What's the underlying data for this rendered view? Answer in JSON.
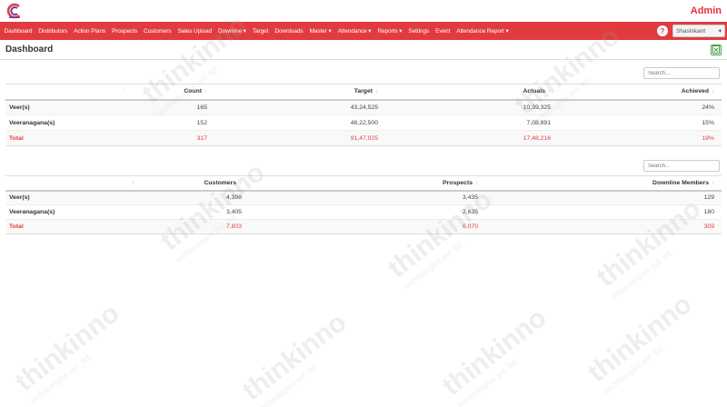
{
  "header": {
    "admin_label": "Admin"
  },
  "nav": {
    "items": [
      {
        "label": "Dashboard",
        "dropdown": false
      },
      {
        "label": "Distributors",
        "dropdown": false
      },
      {
        "label": "Action Plans",
        "dropdown": false
      },
      {
        "label": "Prospects",
        "dropdown": false
      },
      {
        "label": "Customers",
        "dropdown": false
      },
      {
        "label": "Sales Upload",
        "dropdown": false
      },
      {
        "label": "Downline ▾",
        "dropdown": true
      },
      {
        "label": "Target",
        "dropdown": false
      },
      {
        "label": "Downloads",
        "dropdown": false
      },
      {
        "label": "Master ▾",
        "dropdown": true
      },
      {
        "label": "Attendance ▾",
        "dropdown": true
      },
      {
        "label": "Reports ▾",
        "dropdown": true
      },
      {
        "label": "Settings",
        "dropdown": false
      },
      {
        "label": "Event",
        "dropdown": false
      },
      {
        "label": "Attendance Report ▾",
        "dropdown": true
      }
    ],
    "help_icon": "?",
    "user": "Shashikant"
  },
  "page": {
    "title": "Dashboard"
  },
  "table1": {
    "search_placeholder": "Search...",
    "columns": [
      "",
      "Count",
      "Target",
      "Actuals",
      "Achieved"
    ],
    "rows": [
      {
        "label": "Veer(s)",
        "count": "165",
        "target": "43,24,525",
        "actuals": "10,39,325",
        "achieved": "24%"
      },
      {
        "label": "Veeranagana(s)",
        "count": "152",
        "target": "48,22,500",
        "actuals": "7,08,891",
        "achieved": "15%"
      }
    ],
    "total": {
      "label": "Total",
      "count": "317",
      "target": "91,47,025",
      "actuals": "17,48,216",
      "achieved": "19%"
    }
  },
  "table2": {
    "search_placeholder": "Search...",
    "columns": [
      "",
      "Customers",
      "Prospects",
      "Downline Members"
    ],
    "rows": [
      {
        "label": "Veer(s)",
        "customers": "4,398",
        "prospects": "3,435",
        "downline": "129"
      },
      {
        "label": "Veeranagana(s)",
        "customers": "3,405",
        "prospects": "2,635",
        "downline": "180"
      }
    ],
    "total": {
      "label": "Total",
      "customers": "7,803",
      "prospects": "6,070",
      "downline": "309"
    }
  },
  "watermark": {
    "brand": "thinkinno",
    "sub": "technologies pvt. ltd."
  },
  "colors": {
    "brand_red": "#e23b3f",
    "total_red": "#e23b3f",
    "export_green": "#4a9f4a"
  }
}
